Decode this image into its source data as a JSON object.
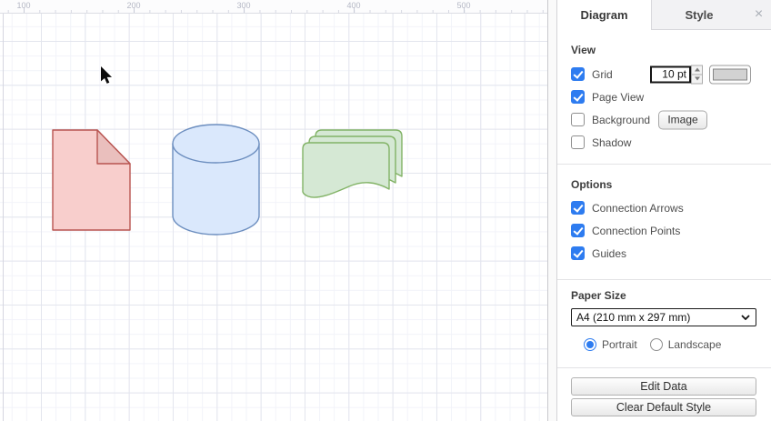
{
  "canvas": {
    "ruler_labels": [
      "100",
      "200",
      "300",
      "400",
      "500"
    ],
    "shapes": [
      {
        "name": "note",
        "fill": "#f8cecc",
        "fold_fill": "#eabfbd",
        "stroke": "#b85450"
      },
      {
        "name": "cylinder",
        "fill": "#dae8fc",
        "stroke": "#6c8ebf"
      },
      {
        "name": "multi-document",
        "fill": "#d5e8d4",
        "stroke": "#82b366"
      }
    ]
  },
  "panel": {
    "tabs": [
      {
        "label": "Diagram",
        "active": true
      },
      {
        "label": "Style",
        "active": false
      }
    ],
    "close_icon": "×",
    "view": {
      "title": "View",
      "grid": {
        "label": "Grid",
        "checked": true,
        "size_value": "10 pt",
        "swatch_color": "#d2d2d2"
      },
      "page_view": {
        "label": "Page View",
        "checked": true
      },
      "background": {
        "label": "Background",
        "checked": false,
        "button_label": "Image"
      },
      "shadow": {
        "label": "Shadow",
        "checked": false
      }
    },
    "options": {
      "title": "Options",
      "items": [
        {
          "label": "Connection Arrows",
          "checked": true
        },
        {
          "label": "Connection Points",
          "checked": true
        },
        {
          "label": "Guides",
          "checked": true
        }
      ]
    },
    "paper": {
      "title": "Paper Size",
      "selected": "A4 (210 mm x 297 mm)",
      "orientation": [
        {
          "label": "Portrait",
          "checked": true
        },
        {
          "label": "Landscape",
          "checked": false
        }
      ]
    },
    "buttons": [
      {
        "label": "Edit Data"
      },
      {
        "label": "Clear Default Style"
      }
    ]
  },
  "colors": {
    "accent": "#2e7cf0",
    "grid_minor": "#f2f3f9",
    "grid_major": "#e3e5ee"
  }
}
